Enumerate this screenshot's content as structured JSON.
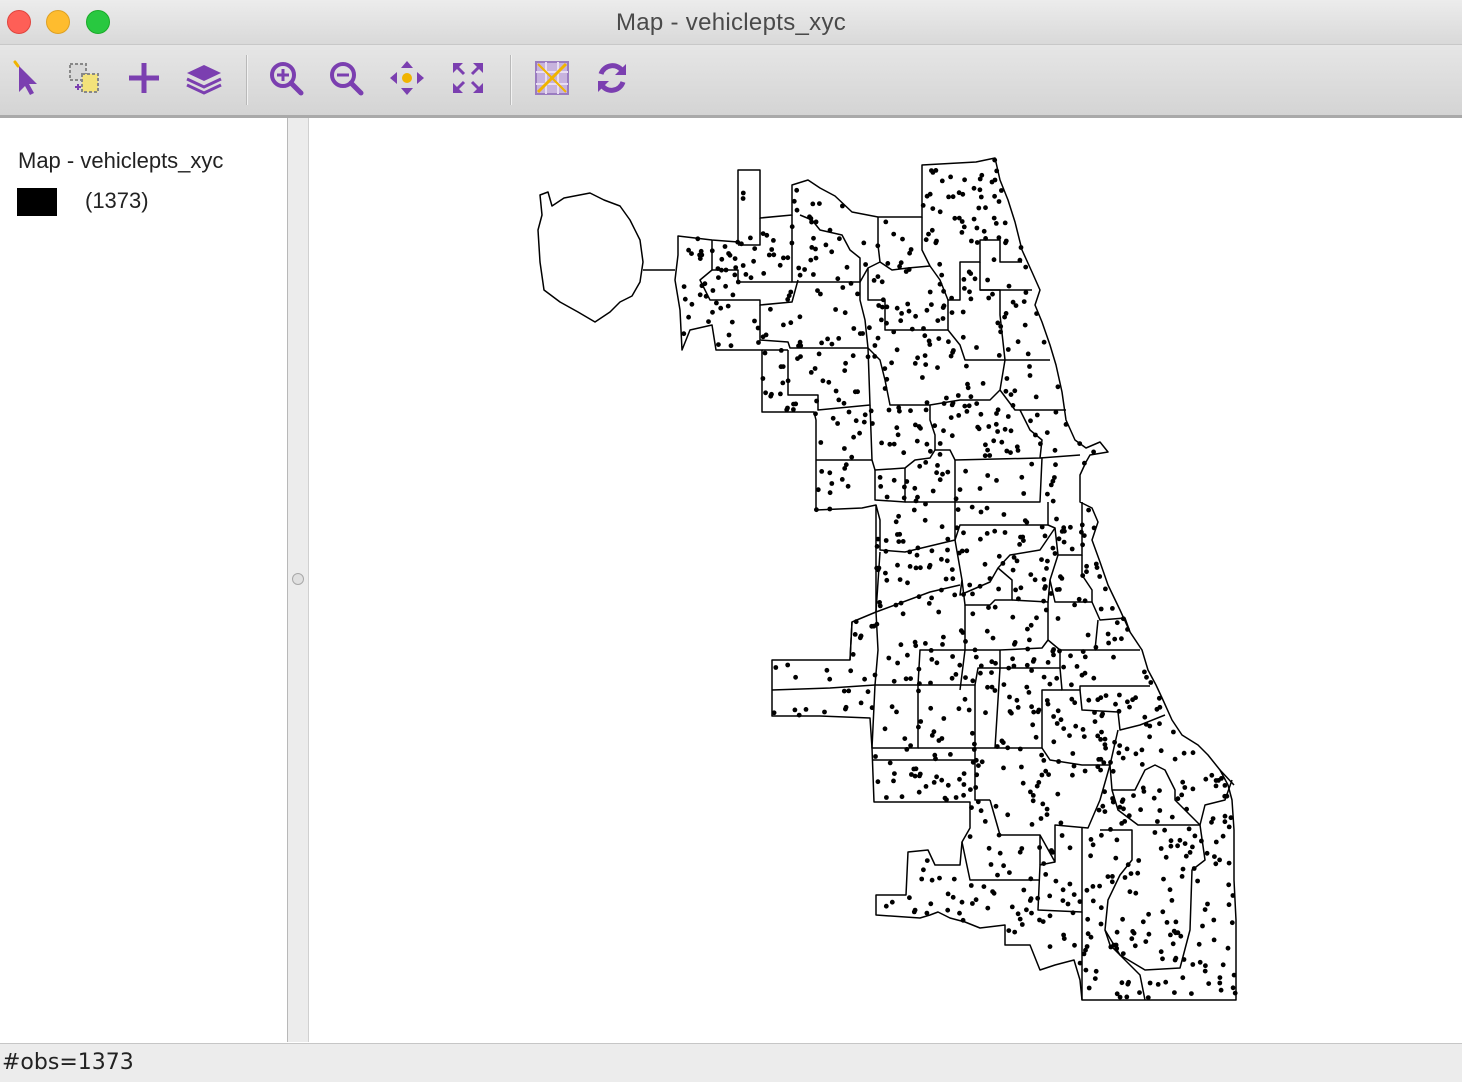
{
  "window": {
    "title": "Map - vehiclepts_xyc"
  },
  "toolbar": {
    "tools": [
      {
        "name": "select-tool",
        "icon": "pointer-arrow-icon"
      },
      {
        "name": "selection-shape-tool",
        "icon": "selection-shape-icon"
      },
      {
        "name": "add-layer-tool",
        "icon": "plus-icon"
      },
      {
        "name": "layers-tool",
        "icon": "layers-icon"
      },
      {
        "name": "zoom-in-tool",
        "icon": "zoom-in-icon"
      },
      {
        "name": "zoom-out-tool",
        "icon": "zoom-out-icon"
      },
      {
        "name": "pan-tool",
        "icon": "move-arrows-icon"
      },
      {
        "name": "full-extent-tool",
        "icon": "expand-icon"
      },
      {
        "name": "basemap-tool",
        "icon": "basemap-icon"
      },
      {
        "name": "refresh-tool",
        "icon": "refresh-icon"
      }
    ],
    "accent_color": "#7b3fb0"
  },
  "legend": {
    "title": "Map - vehiclepts_xyc",
    "items": [
      {
        "color": "#000000",
        "label": "(1373)"
      }
    ]
  },
  "map": {
    "layer": "vehiclepts_xyc",
    "point_count": 1373,
    "point_color": "#000000",
    "outline_color": "#000000"
  },
  "status": {
    "text": "#obs=1373"
  }
}
